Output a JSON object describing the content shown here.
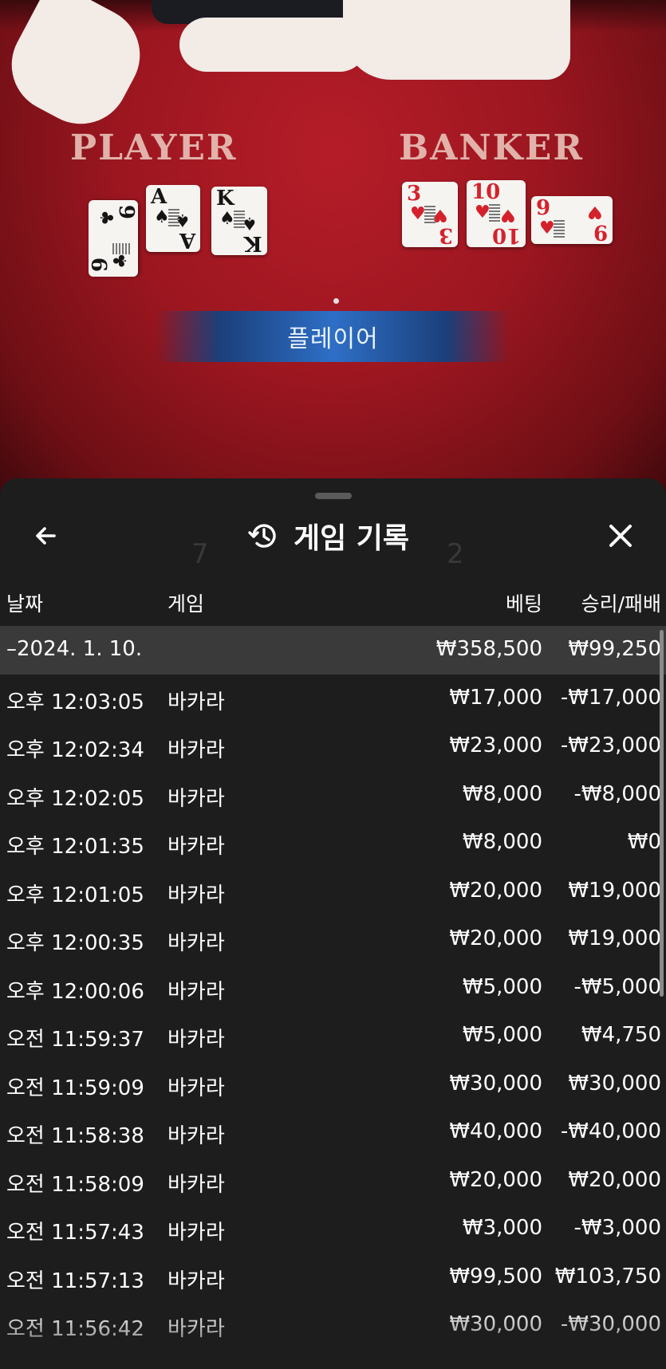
{
  "game": {
    "player_label": "PLAYER",
    "banker_label": "BANKER",
    "result_text": "플레이어",
    "player_cards": [
      {
        "rank": "9",
        "suit": "♣",
        "color": "black"
      },
      {
        "rank": "A",
        "suit": "♠",
        "color": "black"
      },
      {
        "rank": "K",
        "suit": "♠",
        "color": "black"
      }
    ],
    "banker_cards": [
      {
        "rank": "3",
        "suit": "♥",
        "color": "red"
      },
      {
        "rank": "10",
        "suit": "♥",
        "color": "red"
      },
      {
        "rank": "9",
        "suit": "♥",
        "color": "red"
      }
    ]
  },
  "sheet": {
    "title": "게임 기록",
    "icons": {
      "back": "arrow-left-icon",
      "history": "history-icon",
      "close": "close-icon"
    },
    "columns": {
      "date": "날짜",
      "game": "게임",
      "bet": "베팅",
      "win_loss": "승리/패배"
    },
    "summary": {
      "date": "–2024. 1. 10.",
      "bet": "₩358,500",
      "win_loss": "₩99,250"
    },
    "rows": [
      {
        "time": "오후 12:03:05",
        "game": "바카라",
        "bet": "₩17,000",
        "win_loss": "-₩17,000"
      },
      {
        "time": "오후 12:02:34",
        "game": "바카라",
        "bet": "₩23,000",
        "win_loss": "-₩23,000"
      },
      {
        "time": "오후 12:02:05",
        "game": "바카라",
        "bet": "₩8,000",
        "win_loss": "-₩8,000"
      },
      {
        "time": "오후 12:01:35",
        "game": "바카라",
        "bet": "₩8,000",
        "win_loss": "₩0"
      },
      {
        "time": "오후 12:01:05",
        "game": "바카라",
        "bet": "₩20,000",
        "win_loss": "₩19,000"
      },
      {
        "time": "오후 12:00:35",
        "game": "바카라",
        "bet": "₩20,000",
        "win_loss": "₩19,000"
      },
      {
        "time": "오후 12:00:06",
        "game": "바카라",
        "bet": "₩5,000",
        "win_loss": "-₩5,000"
      },
      {
        "time": "오전 11:59:37",
        "game": "바카라",
        "bet": "₩5,000",
        "win_loss": "₩4,750"
      },
      {
        "time": "오전 11:59:09",
        "game": "바카라",
        "bet": "₩30,000",
        "win_loss": "₩30,000"
      },
      {
        "time": "오전 11:58:38",
        "game": "바카라",
        "bet": "₩40,000",
        "win_loss": "-₩40,000"
      },
      {
        "time": "오전 11:58:09",
        "game": "바카라",
        "bet": "₩20,000",
        "win_loss": "₩20,000"
      },
      {
        "time": "오전 11:57:43",
        "game": "바카라",
        "bet": "₩3,000",
        "win_loss": "-₩3,000"
      },
      {
        "time": "오전 11:57:13",
        "game": "바카라",
        "bet": "₩99,500",
        "win_loss": "₩103,750"
      },
      {
        "time": "오전 11:56:42",
        "game": "바카라",
        "bet": "₩30,000",
        "win_loss": "-₩30,000"
      }
    ]
  }
}
